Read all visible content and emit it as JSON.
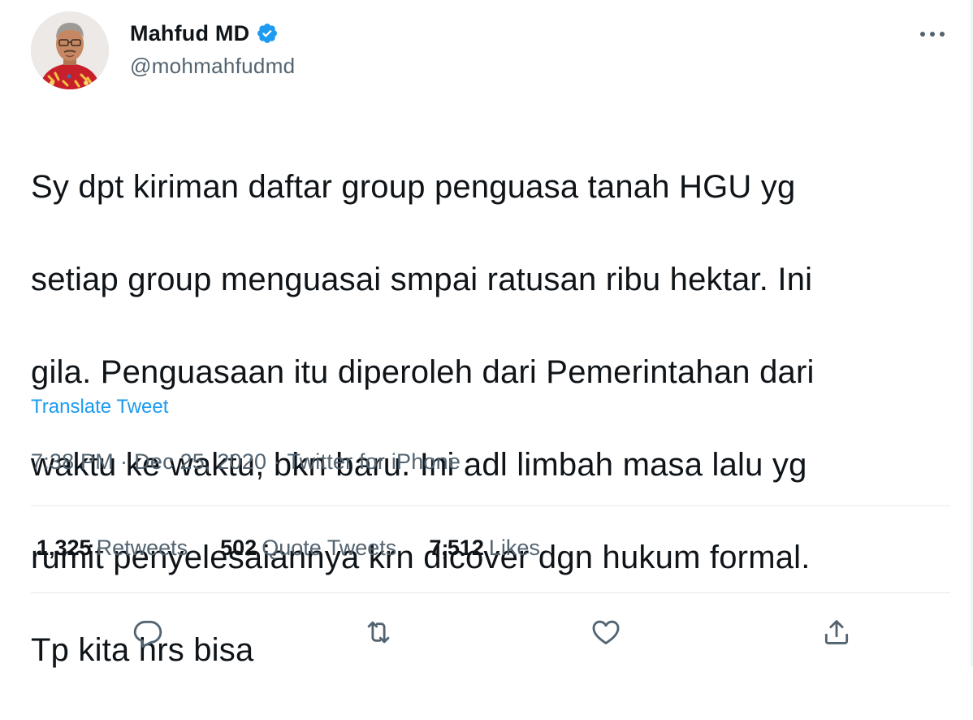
{
  "author": {
    "name": "Mahfud MD",
    "handle": "@mohmahfudmd",
    "verified_icon": "verified-badge-icon"
  },
  "tweet": {
    "lines": [
      "Sy dpt kiriman daftar group penguasa tanah HGU yg",
      "setiap group menguasai smpai ratusan ribu hektar. Ini",
      "gila. Penguasaan itu diperoleh dari Pemerintahan dari",
      "waktu ke waktu, bkn baru. Ini adl limbah masa lalu yg",
      "rumit penyelesaiannya krn dicover dgn hukum formal.",
      "Tp kita hrs bisa"
    ],
    "translate_label": "Translate Tweet"
  },
  "meta": {
    "time": "7:38 PM",
    "separator": "·",
    "date": "Dec 25, 2020",
    "source": "Twitter for iPhone"
  },
  "stats": {
    "retweets": {
      "count": "1,325",
      "label": "Retweets"
    },
    "quotes": {
      "count": "502",
      "label": "Quote Tweets"
    },
    "likes": {
      "count": "7,512",
      "label": "Likes"
    }
  },
  "actions": {
    "reply_icon": "reply-icon",
    "retweet_icon": "retweet-icon",
    "like_icon": "like-icon",
    "share_icon": "share-icon",
    "more_icon": "more-icon"
  },
  "colors": {
    "text": "#0f1419",
    "secondary": "#536471",
    "link": "#1d9bf0",
    "verified": "#1d9bf0",
    "divider": "#e6e9eb"
  }
}
